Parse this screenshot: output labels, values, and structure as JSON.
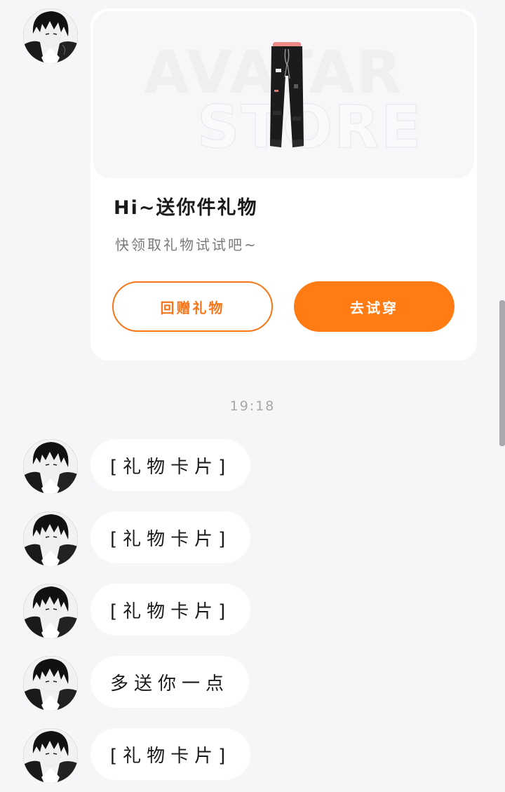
{
  "gift_card": {
    "banner_watermark_line1": "AVATAR",
    "banner_watermark_line2": "STORE",
    "title": "Hi~送你件礼物",
    "subtitle": "快领取礼物试试吧~",
    "return_gift_label": "回赠礼物",
    "try_on_label": "去试穿"
  },
  "timestamp": "19:18",
  "messages": [
    {
      "text": "[礼物卡片]"
    },
    {
      "text": "[礼物卡片]"
    },
    {
      "text": "[礼物卡片]"
    },
    {
      "text": "多送你一点"
    },
    {
      "text": "[礼物卡片]"
    }
  ],
  "colors": {
    "accent": "#ff7b14",
    "background": "#f6f6f8",
    "bubble": "#ffffff"
  },
  "icons": {
    "avatar": "anime-boy-avatar",
    "product": "black-pants-product"
  }
}
